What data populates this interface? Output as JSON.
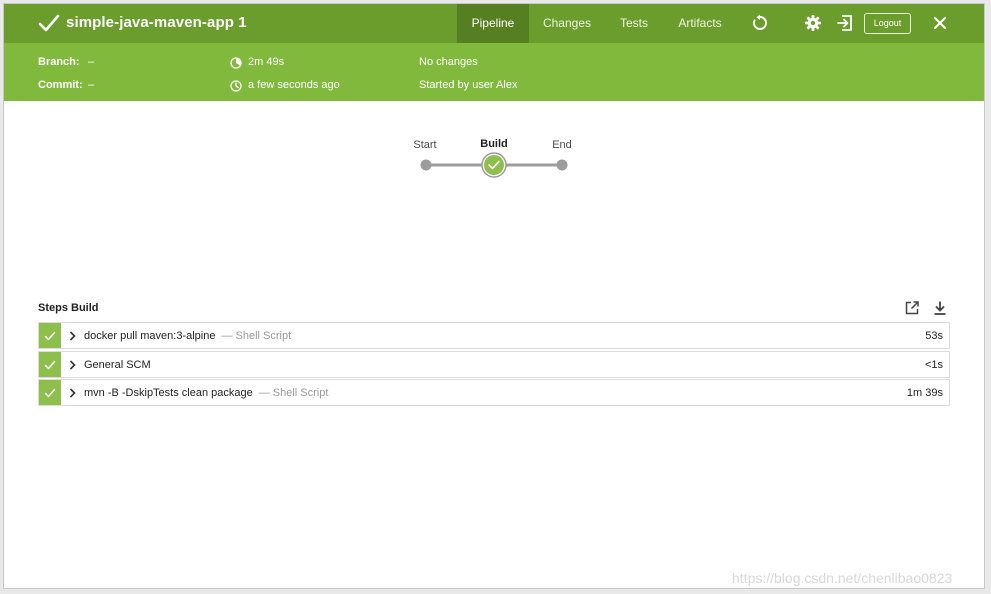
{
  "header": {
    "title": "simple-java-maven-app 1",
    "tabs": [
      {
        "label": "Pipeline",
        "active": true
      },
      {
        "label": "Changes",
        "active": false
      },
      {
        "label": "Tests",
        "active": false
      },
      {
        "label": "Artifacts",
        "active": false
      }
    ],
    "icons": [
      "replay-icon",
      "gear-icon",
      "exit-icon",
      "close-icon"
    ],
    "logout_label": "Logout"
  },
  "info": {
    "branch_label": "Branch:",
    "branch_value": "–",
    "commit_label": "Commit:",
    "commit_value": "–",
    "duration": "2m 49s",
    "time_ago": "a few seconds ago",
    "changes": "No changes",
    "started_by": "Started by user Alex"
  },
  "pipeline": {
    "stages": [
      {
        "label": "Start",
        "current": false
      },
      {
        "label": "Build",
        "current": true
      },
      {
        "label": "End",
        "current": false
      }
    ]
  },
  "steps": {
    "title": "Steps Build",
    "rows": [
      {
        "name": "docker pull maven:3-alpine",
        "type": "— Shell Script",
        "duration": "53s"
      },
      {
        "name": "General SCM",
        "type": "",
        "duration": "<1s"
      },
      {
        "name": "mvn -B -DskipTests clean package",
        "type": "— Shell Script",
        "duration": "1m 39s"
      }
    ]
  },
  "colors": {
    "header_bg": "#6a9d2b",
    "info_bg": "#80b93b",
    "success": "#8cc04b"
  },
  "watermark": "https://blog.csdn.net/chenlibao0823"
}
